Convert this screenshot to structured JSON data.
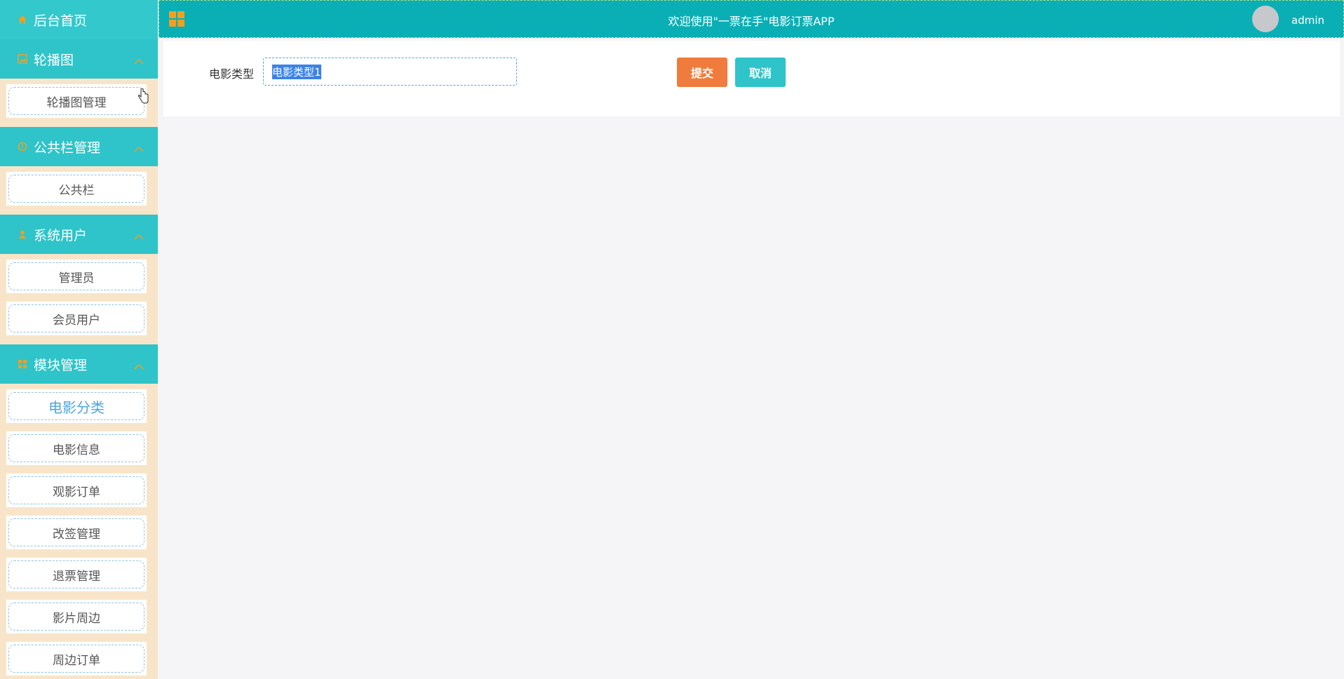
{
  "sidebar": {
    "home": {
      "label": "后台首页"
    },
    "groups": [
      {
        "label": "轮播图",
        "items": [
          {
            "label": "轮播图管理"
          }
        ]
      },
      {
        "label": "公共栏管理",
        "items": [
          {
            "label": "公共栏"
          }
        ]
      },
      {
        "label": "系统用户",
        "items": [
          {
            "label": "管理员"
          },
          {
            "label": "会员用户"
          }
        ]
      },
      {
        "label": "模块管理",
        "items": [
          {
            "label": "电影分类"
          },
          {
            "label": "电影信息"
          },
          {
            "label": "观影订单"
          },
          {
            "label": "改签管理"
          },
          {
            "label": "退票管理"
          },
          {
            "label": "影片周边"
          },
          {
            "label": "周边订单"
          }
        ]
      }
    ]
  },
  "header": {
    "title": "欢迎使用\"一票在手\"电影订票APP",
    "username": "admin"
  },
  "form": {
    "field_label": "电影类型",
    "field_value": "电影类型1",
    "submit_label": "提交",
    "cancel_label": "取消"
  },
  "colors": {
    "accent": "#2ec4c9",
    "topbar": "#0aafb5",
    "sidebar_bg": "#f8e5c9",
    "submit": "#ef7c3c",
    "icon": "#f0a020"
  },
  "icons": [
    "home-icon",
    "image-icon",
    "info-icon",
    "user-icon",
    "module-icon",
    "chevron-up-icon",
    "grid-menu-icon",
    "avatar"
  ]
}
